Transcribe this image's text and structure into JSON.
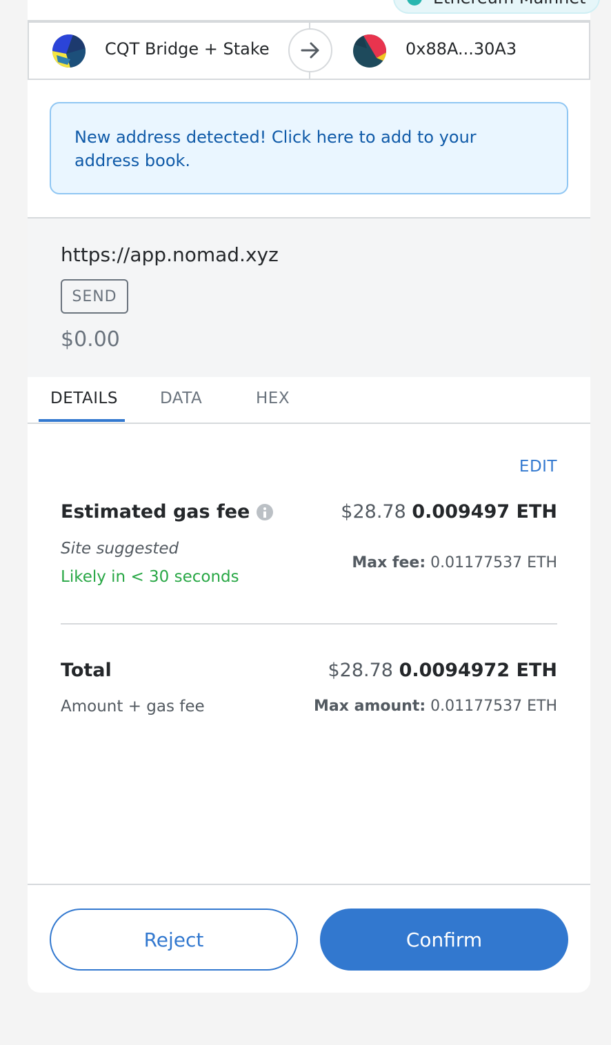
{
  "network": {
    "label": "Ethereum Mainnet",
    "dot_color": "#29b6af"
  },
  "sender": {
    "name": "CQT Bridge + Stake",
    "avatar": "sender-identicon"
  },
  "recipient": {
    "address": "0x88A...30A3",
    "avatar": "recipient-identicon"
  },
  "arrow_icon": "arrow-right-icon",
  "banner": {
    "text": "New address detected! Click here to add to your address book."
  },
  "origin": {
    "url": "https://app.nomad.xyz",
    "method": "SEND",
    "value": "$0.00"
  },
  "tabs": [
    {
      "label": "DETAILS",
      "active": true
    },
    {
      "label": "DATA",
      "active": false
    },
    {
      "label": "HEX",
      "active": false
    }
  ],
  "details": {
    "edit_label": "EDIT",
    "gas": {
      "label": "Estimated gas fee",
      "fiat": "$28.78",
      "eth": "0.009497 ETH",
      "site_suggested": "Site suggested",
      "likely": "Likely in < 30 seconds",
      "max_fee_label": "Max fee:",
      "max_fee_value": "0.01177537 ETH"
    },
    "total": {
      "label": "Total",
      "fiat": "$28.78",
      "eth": "0.0094972 ETH",
      "sub_label": "Amount + gas fee",
      "max_amount_label": "Max amount:",
      "max_amount_value": "0.01177537 ETH"
    }
  },
  "footer": {
    "reject_label": "Reject",
    "confirm_label": "Confirm"
  },
  "colors": {
    "primary": "#3278cf",
    "success": "#28a745",
    "banner_bg": "#eaf6ff"
  }
}
